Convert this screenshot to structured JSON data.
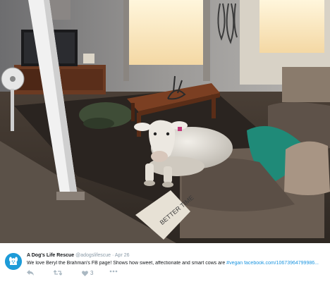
{
  "tweet": {
    "display_name": "A Dog's Life Rescue",
    "handle": "@adogslifescue",
    "separator": "·",
    "date": "Apr 26",
    "text_before": "We love Beryl the Brahman's FB page! Shows how sweet, affectionate and smart cows are ",
    "hashtag": "#vegan",
    "url": "facebook.com/10673964799986..."
  },
  "photo": {
    "cushion_text": "BETTER TIME"
  },
  "actions": {
    "like_count": "3"
  },
  "colors": {
    "link": "#1b95e0",
    "avatar": "#1d9bd8"
  },
  "icons": [
    "reply-icon",
    "retweet-icon",
    "like-icon",
    "more-icon"
  ]
}
